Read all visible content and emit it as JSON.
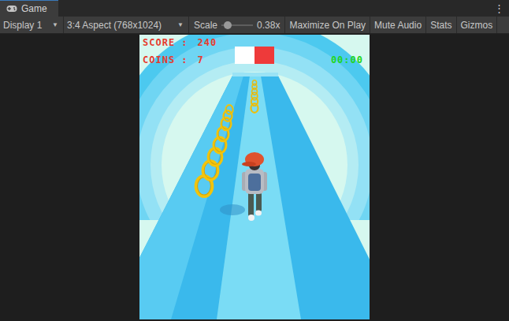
{
  "window": {
    "title": "Game",
    "menu": "⋮"
  },
  "toolbar": {
    "display": {
      "label": "Display 1",
      "arrow": "▼"
    },
    "aspect": {
      "label": "3:4 Aspect (768x1024)",
      "arrow": "▼"
    },
    "scale": {
      "label": "Scale",
      "level": 0.1,
      "reading": "0.38x"
    },
    "toggles": [
      {
        "label": "Maximize On Play",
        "on": false
      },
      {
        "label": "Mute Audio",
        "on": false
      },
      {
        "label": "Stats",
        "on": false
      },
      {
        "label": "Gizmos",
        "on": false
      }
    ]
  },
  "hud": {
    "score_label": "SCORE :",
    "score": "240",
    "coins_label": "COINS :",
    "coins": "7",
    "timer": "00:00"
  }
}
